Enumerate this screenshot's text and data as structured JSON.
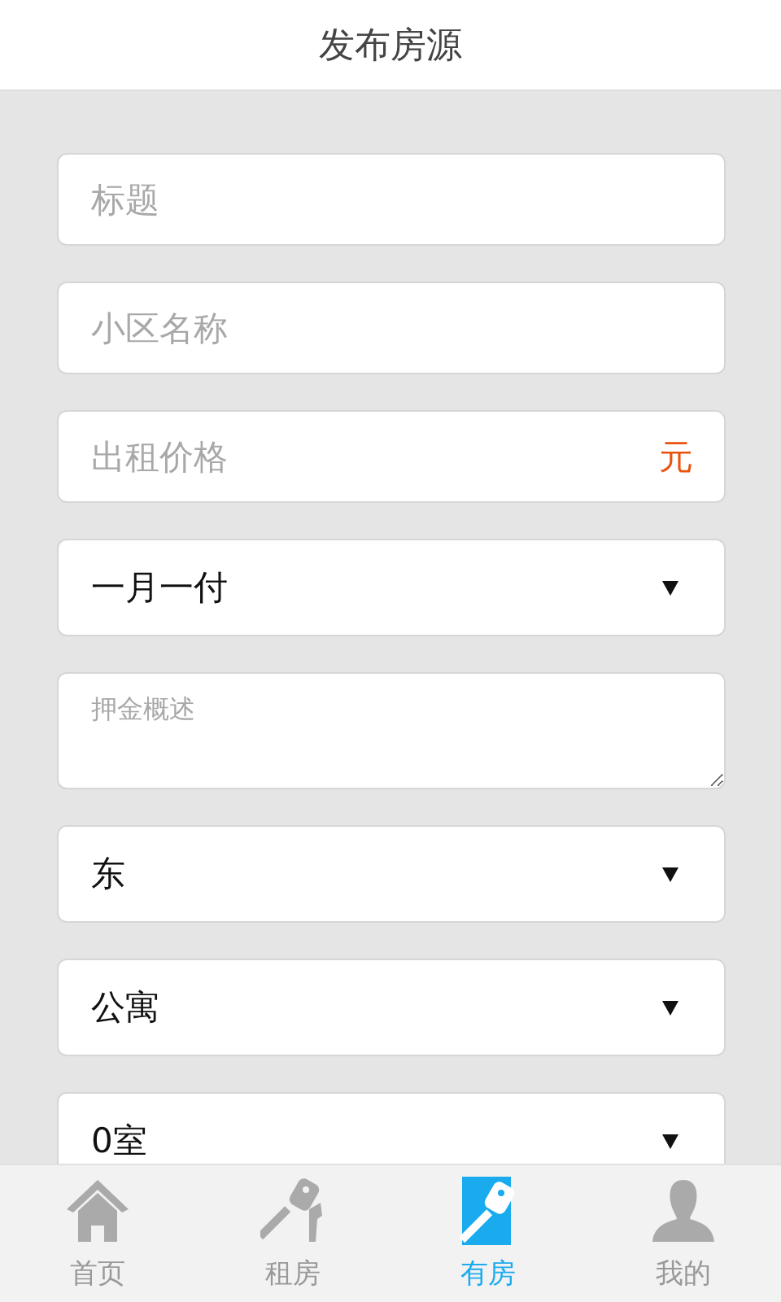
{
  "header": {
    "title": "发布房源"
  },
  "fields": [
    {
      "kind": "input",
      "placeholder": "标题"
    },
    {
      "kind": "input",
      "placeholder": "小区名称"
    },
    {
      "kind": "input",
      "placeholder": "出租价格",
      "suffix": "元"
    },
    {
      "kind": "select",
      "value": "一月一付"
    },
    {
      "kind": "textarea",
      "placeholder": "押金概述"
    },
    {
      "kind": "select",
      "value": "东"
    },
    {
      "kind": "select",
      "value": "公寓"
    },
    {
      "kind": "select",
      "value": "0室"
    }
  ],
  "tabs": [
    {
      "label": "首页",
      "selected": false
    },
    {
      "label": "租房",
      "selected": false
    },
    {
      "label": "有房",
      "selected": true
    },
    {
      "label": "我的",
      "selected": false
    }
  ]
}
